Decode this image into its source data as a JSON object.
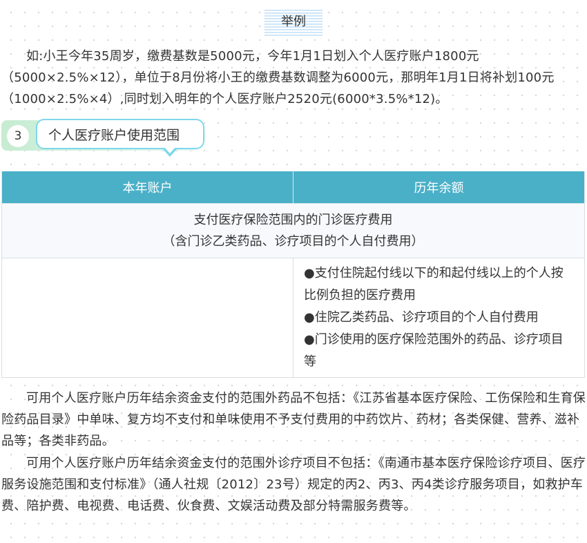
{
  "example": {
    "label": "举例",
    "text": "如:小王今年35周岁，缴费基数是5000元，今年1月1日划入个人医疗账户1800元（5000×2.5%×12），单位于8月份将小王的缴费基数调整为6000元，那明年1月1日将补划100元（1000×2.5%×4）,同时划入明年的个人医疗账户2520元(6000*3.5%*12)。"
  },
  "section": {
    "number": "3",
    "title": "个人医疗账户使用范围"
  },
  "table": {
    "headers": [
      "本年账户",
      "历年余额"
    ],
    "shared_row": {
      "line1": "支付医疗保险范围内的门诊医疗费用",
      "line2": "（含门诊乙类药品、诊疗项目的个人自付费用）"
    },
    "left_cell": "",
    "right_items": [
      "●支付住院起付线以下的和起付线以上的个人按比例负担的医疗费用",
      "●住院乙类药品、诊疗项目的个人自付费用",
      "●门诊使用的医疗保险范围外的药品、诊疗项目等"
    ]
  },
  "notes": {
    "drugs": "可用个人医疗账户历年结余资金支付的范围外药品不包括：《江苏省基本医疗保险、工伤保险和生育保险药品目录》中单味、复方均不支付和单味使用不予支付费用的中药饮片、药材；各类保健、营养、滋补品等；各类非药品。",
    "services": "可用个人医疗账户历年结余资金支付的范围外诊疗项目不包括：《南通市基本医疗保险诊疗项目、医疗服务设施范围和支付标准》（通人社规〔2012〕23号）规定的丙2、丙3、丙4类诊疗服务项目，如救护车费、陪护费、电视费、电话费、伙食费、文娱活动费及部分特需服务费等。"
  },
  "colors": {
    "table_header": "#4ab0c8",
    "section_border": "#7ed7ec",
    "section_gradient_start": "#c6ecd1",
    "label_stripe": "#cfe6f8"
  }
}
